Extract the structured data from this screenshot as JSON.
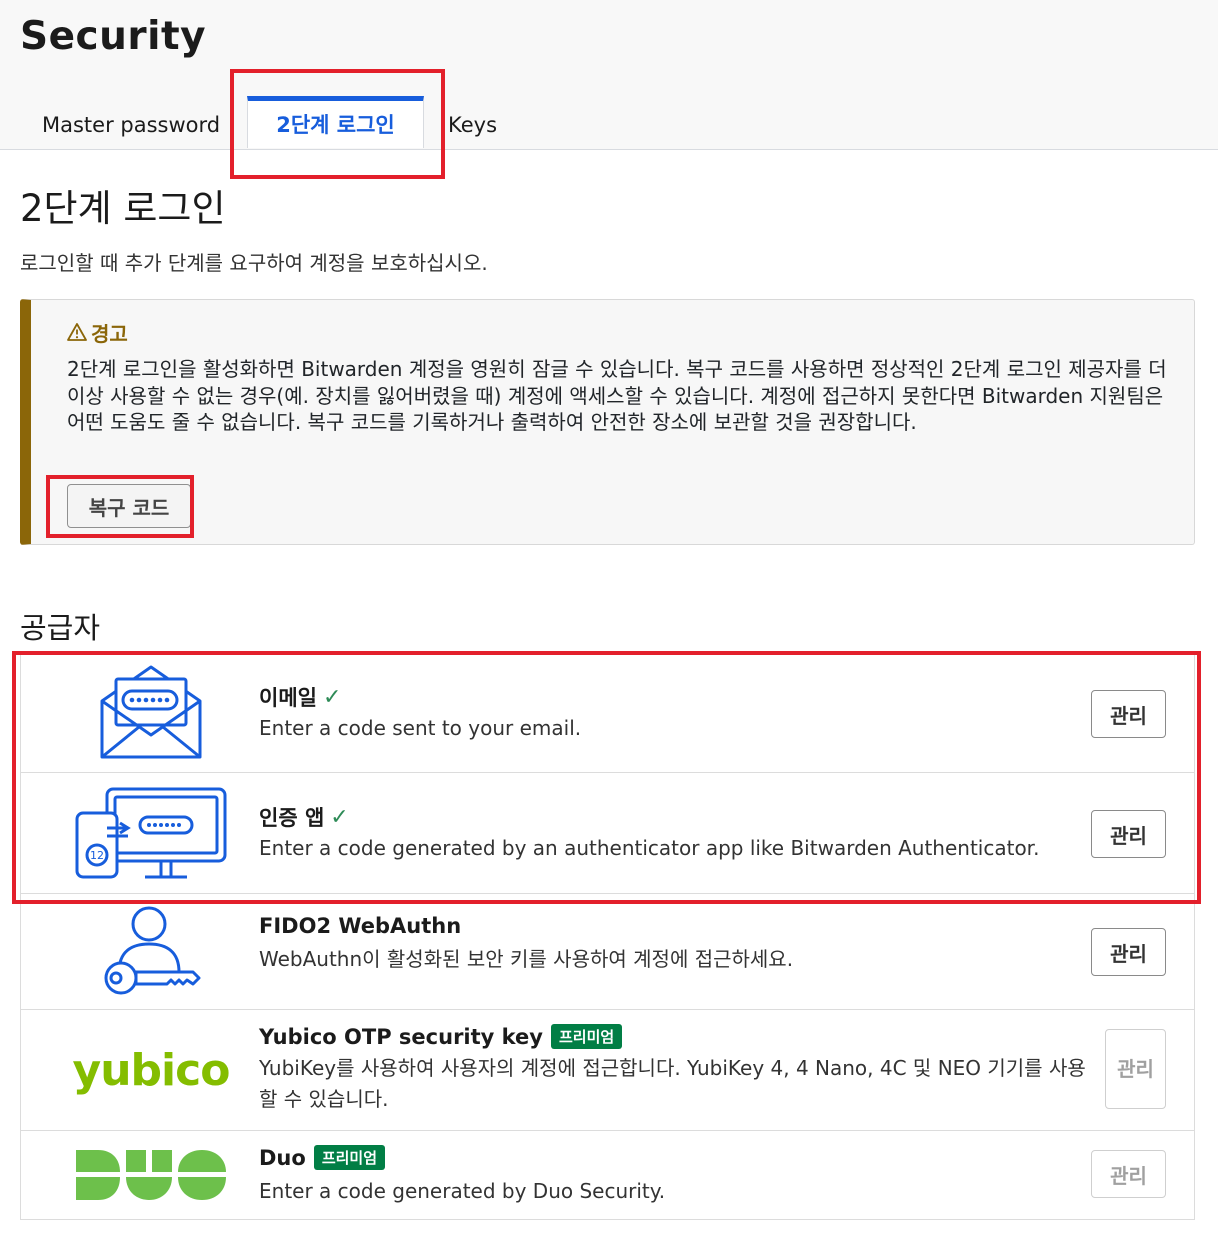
{
  "page_title": "Security",
  "tabs": [
    {
      "label": "Master password",
      "active": false
    },
    {
      "label": "2단계 로그인",
      "active": true
    },
    {
      "label": "Keys",
      "active": false
    }
  ],
  "section": {
    "title": "2단계 로그인",
    "description": "로그인할 때 추가 단계를 요구하여 계정을 보호하십시오."
  },
  "warning": {
    "icon": "warning-triangle-icon",
    "heading": "경고",
    "body": "2단계 로그인을 활성화하면 Bitwarden 계정을 영원히 잠글 수 있습니다. 복구 코드를 사용하면 정상적인 2단계 로그인 제공자를 더 이상 사용할 수 없는 경우(예. 장치를 잃어버렸을 때) 계정에 액세스할 수 있습니다. 계정에 접근하지 못한다면 Bitwarden 지원팀은 어떤 도움도 줄 수 없습니다. 복구 코드를 기록하거나 출력하여 안전한 장소에 보관할 것을 권장합니다.",
    "recovery_button": "복구 코드"
  },
  "providers_title": "공급자",
  "providers": [
    {
      "name": "이메일",
      "enabled_check": "✓",
      "description": "Enter a code sent to your email.",
      "manage": "관리",
      "icon": "email-icon"
    },
    {
      "name": "인증 앱",
      "enabled_check": "✓",
      "description": "Enter a code generated by an authenticator app like Bitwarden Authenticator.",
      "manage": "관리",
      "icon": "authenticator-app-icon",
      "phone_code": "12"
    },
    {
      "name": "FIDO2 WebAuthn",
      "description": "WebAuthn이 활성화된 보안 키를 사용하여 계정에 접근하세요.",
      "manage": "관리",
      "icon": "user-key-icon"
    },
    {
      "name": "Yubico OTP security key",
      "badge": "프리미엄",
      "description": "YubiKey를 사용하여 사용자의 계정에 접근합니다. YubiKey 4, 4 Nano, 4C 및 NEO 기기를 사용할 수 있습니다.",
      "manage": "관리",
      "logo_text": "yubico",
      "icon": "yubico-logo"
    },
    {
      "name": "Duo",
      "badge": "프리미엄",
      "description": "Enter a code generated by Duo Security.",
      "manage": "관리",
      "icon": "duo-logo"
    }
  ],
  "colors": {
    "accent": "#175ddc",
    "warning": "#8b6609",
    "premium": "#017e45",
    "highlight": "#e3202b",
    "yubico": "#84bd00",
    "duo": "#6dc04b"
  }
}
